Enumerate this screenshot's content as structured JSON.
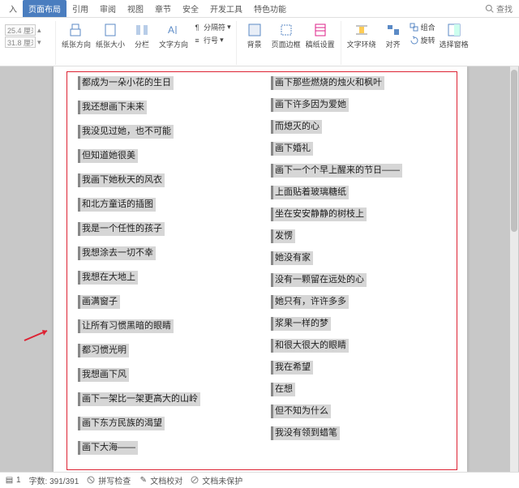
{
  "tabs": {
    "items": [
      "入",
      "页面布局",
      "引用",
      "审阅",
      "视图",
      "章节",
      "安全",
      "开发工具",
      "特色功能"
    ],
    "active_index": 1,
    "search": "查找"
  },
  "ribbon": {
    "margin_top": "25.4 厘米",
    "margin_side": "31.8 厘米",
    "orientation": "纸张方向",
    "size": "纸张大小",
    "columns": "分栏",
    "textdir": "文字方向",
    "breaks": "分隔符",
    "linenum": "行号",
    "bg": "背景",
    "border": "页面边框",
    "manuscript": "稿纸设置",
    "wrap": "文字环绕",
    "align": "对齐",
    "group": "组合",
    "rotate": "旋转",
    "selpane": "选择窗格"
  },
  "doc": {
    "left": [
      "都成为一朵小花的生日",
      "我还想画下未来",
      "我没见过她，也不可能",
      "但知道她很美",
      "我画下她秋天的风衣",
      "和北方童话的插图",
      "我是一个任性的孩子",
      "我想涂去一切不幸",
      "我想在大地上",
      "画满窗子",
      "让所有习惯黑暗的眼睛",
      "都习惯光明",
      "我想画下风",
      "画下一架比一架更高大的山岭",
      "画下东方民族的渴望",
      "画下大海——"
    ],
    "right": [
      "画下那些燃烧的烛火和枫叶",
      "画下许多因为爱她",
      "而熄灭的心",
      "画下婚礼",
      "画下一个个早上醒来的节日——",
      "上面贴着玻璃糖纸",
      "坐在安安静静的树枝上",
      "发愣",
      "她没有家",
      "没有一颗留在远处的心",
      "她只有，许许多多",
      "浆果一样的梦",
      "和很大很大的眼睛",
      "我在希望",
      "在想",
      "但不知为什么",
      "我没有领到蜡笔"
    ]
  },
  "status": {
    "page": "1",
    "words": "字数: 391/391",
    "spell": "拼写检查",
    "proof": "文档校对",
    "protect": "文档未保护"
  }
}
